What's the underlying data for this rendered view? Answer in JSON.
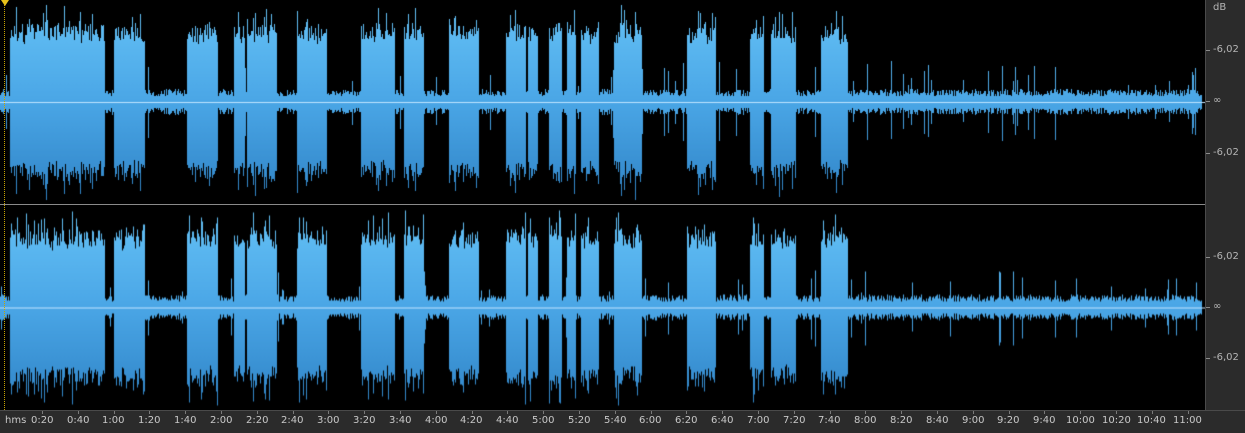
{
  "app": {
    "view": "waveform-editor",
    "waveform_color": "#4aa6e6",
    "waveform_highlight": "#66c3f7",
    "background": "#000000",
    "ruler_background": "#2b2b2b"
  },
  "db_ruler": {
    "unit": "dB",
    "channel_1": {
      "top_label": "-6,02",
      "center_label": "∞",
      "bottom_label": "-6,02"
    },
    "channel_2": {
      "top_label": "-6,02",
      "center_label": "∞",
      "bottom_label": "-6,02"
    }
  },
  "time_ruler": {
    "unit": "hms",
    "labels": [
      "0:20",
      "0:40",
      "1:00",
      "1:20",
      "1:40",
      "2:00",
      "2:20",
      "2:40",
      "3:00",
      "3:20",
      "3:40",
      "4:00",
      "4:20",
      "4:40",
      "5:00",
      "5:20",
      "5:40",
      "6:00",
      "6:20",
      "6:40",
      "7:00",
      "7:20",
      "7:40",
      "8:00",
      "8:20",
      "8:40",
      "9:00",
      "9:20",
      "9:40",
      "10:00",
      "10:20",
      "10:40",
      "11:00"
    ]
  },
  "waveform": {
    "channels": 2,
    "loud_segments": [
      [
        "0:02",
        "0:55"
      ],
      [
        "1:00",
        "1:17"
      ],
      [
        "1:41",
        "1:58"
      ],
      [
        "2:07",
        "2:13"
      ],
      [
        "2:14",
        "2:31"
      ],
      [
        "2:42",
        "2:59"
      ],
      [
        "3:18",
        "3:37"
      ],
      [
        "3:42",
        "3:53"
      ],
      [
        "4:07",
        "4:24"
      ],
      [
        "4:39",
        "4:50"
      ],
      [
        "4:51",
        "4:57"
      ],
      [
        "5:03",
        "5:10"
      ],
      [
        "5:13",
        "5:18"
      ],
      [
        "5:21",
        "5:31"
      ],
      [
        "5:39",
        "5:55"
      ],
      [
        "6:20",
        "6:36"
      ],
      [
        "6:55",
        "7:03"
      ],
      [
        "7:07",
        "7:21"
      ],
      [
        "7:35",
        "7:50"
      ]
    ]
  }
}
